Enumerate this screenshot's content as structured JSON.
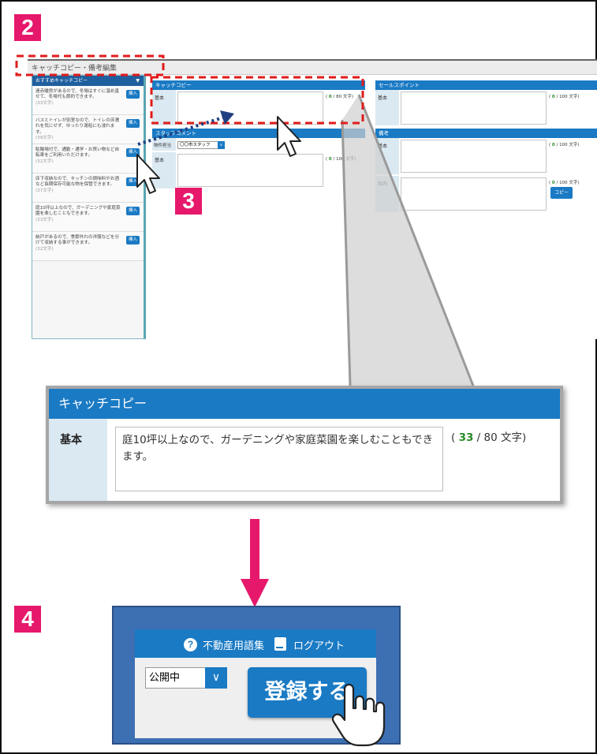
{
  "steps": {
    "s2": "2",
    "s3": "3",
    "s4": "4"
  },
  "colors": {
    "accent_blue": "#1a7ac4",
    "step_badge": "#e6186b",
    "dashed_highlight": "#e01b1b",
    "count_green": "#2a8a2a"
  },
  "top_screen": {
    "title": "キャッチコピー・備考編集",
    "sidebar": {
      "header": "おすすめキャッチコピー",
      "header_icon": "triangle-down-icon",
      "insert_label": "挿入",
      "items": [
        {
          "text": "遠赤暖房があるので、冬場はすぐに温め直せて、冬場代も節約できます。",
          "count": "(33文字)"
        },
        {
          "text": "バスとトイレが別室なので、トイレの床濡れを気にせず、ゆったり湯船にも浸れます。",
          "count": "(39文字)"
        },
        {
          "text": "駐輪場付で、通勤・通学・お買い物など自転車をご利用いただけます。",
          "count": "(32文字)"
        },
        {
          "text": "床下収納なので、キッチンの調味料やお酒など長期保存可能な物を保管できます。",
          "count": "(37文字)"
        },
        {
          "text": "庭10坪以上なので、ガーデニングや家庭菜園を楽しむこともできます。",
          "count": "(33文字)"
        },
        {
          "text": "納戸があるので、季節外れの洋服などを分けて収納する事ができます。",
          "count": "(32文字)"
        }
      ]
    },
    "catch": {
      "header": "キャッチコピー",
      "label": "基本",
      "counter_open": "( ",
      "count": "0",
      "counter_rest": " / 80 文字)"
    },
    "staff": {
      "header": "スタッフコメント",
      "property_label": "物件担当",
      "select_value": "〇〇市スタッフ",
      "label": "基本",
      "counter_open": "( ",
      "count": "0",
      "counter_rest": " / 100 文字)"
    },
    "sales": {
      "header": "セールスポイント",
      "label": "基本",
      "counter_open": "( ",
      "count": "0",
      "counter_rest": " / 100 文字)"
    },
    "remarks": {
      "header": "備考",
      "label": "基本",
      "counter_open": "( ",
      "count": "0",
      "counter_rest": " / 100 文字)",
      "label2": "社内",
      "counter2_open": "( ",
      "count2": "0",
      "counter2_rest": " / 100 文字)",
      "copy_label": "コピー"
    }
  },
  "zoom": {
    "header": "キャッチコピー",
    "label": "基本",
    "text": "庭10坪以上なので、ガーデニングや家庭菜園を楽しむこともできます。",
    "counter_open": "( ",
    "count": "33",
    "counter_rest": " / 80 文字)"
  },
  "bottom_screen": {
    "help_icon_glyph": "?",
    "glossary_label": "不動産用語集",
    "logout_label": "ログアウト",
    "status_value": "公開中",
    "register_label": "登録する"
  }
}
